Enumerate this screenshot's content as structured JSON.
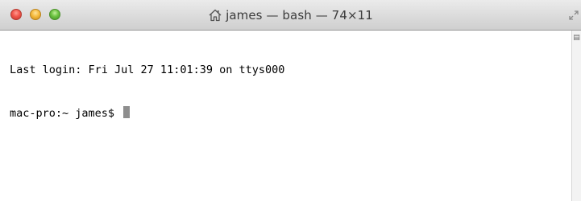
{
  "window": {
    "title": "james — bash — 74×11"
  },
  "terminal": {
    "lines": [
      "Last login: Fri Jul 27 11:01:39 on ttys000",
      "mac-pro:~ james$ "
    ]
  },
  "icons": {
    "title_icon": "home-icon",
    "close": "close-button",
    "minimize": "minimize-button",
    "zoom": "zoom-button"
  },
  "colors": {
    "close": "#f2574c",
    "minimize": "#f6bb3f",
    "zoom": "#6cc341",
    "cursor": "#8e8e8e"
  }
}
